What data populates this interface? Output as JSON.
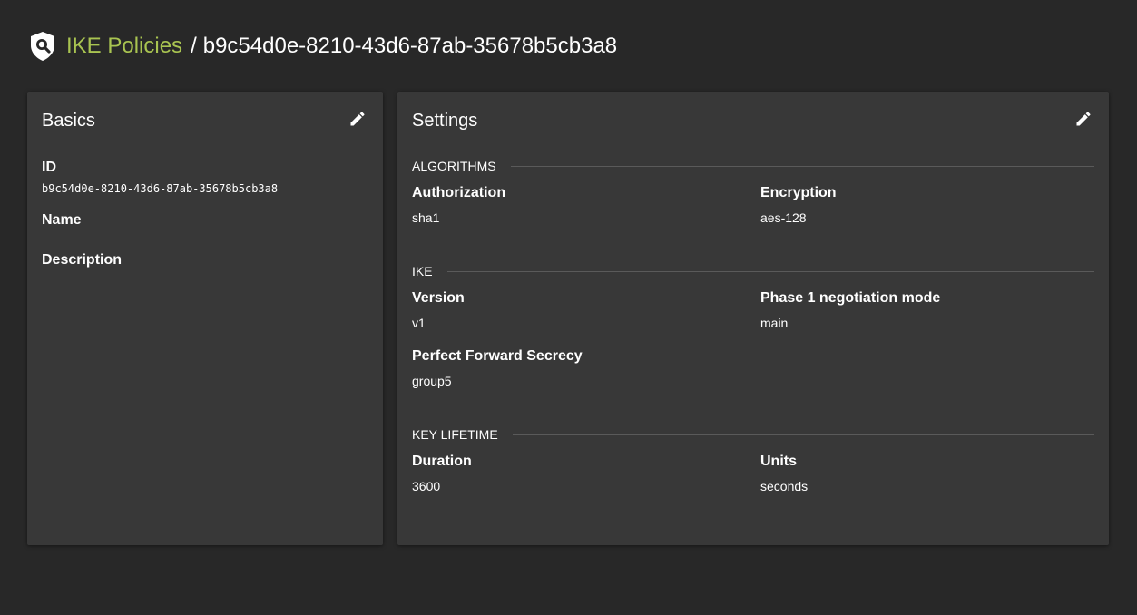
{
  "breadcrumb": {
    "icon": "shield-search-icon",
    "parent_label": "IKE Policies",
    "separator": "/",
    "current": "b9c54d0e-8210-43d6-87ab-35678b5cb3a8"
  },
  "colors": {
    "background": "#282828",
    "card": "#383838",
    "link": "#a9c451"
  },
  "basics": {
    "title": "Basics",
    "edit_icon": "pencil-icon",
    "id_label": "ID",
    "id_value": "b9c54d0e-8210-43d6-87ab-35678b5cb3a8",
    "name_label": "Name",
    "description_label": "Description"
  },
  "settings": {
    "title": "Settings",
    "edit_icon": "pencil-icon",
    "algorithms": {
      "heading": "ALGORITHMS",
      "authorization_label": "Authorization",
      "authorization_value": "sha1",
      "encryption_label": "Encryption",
      "encryption_value": "aes-128"
    },
    "ike": {
      "heading": "IKE",
      "version_label": "Version",
      "version_value": "v1",
      "phase1_label": "Phase 1 negotiation mode",
      "phase1_value": "main",
      "pfs_label": "Perfect Forward Secrecy",
      "pfs_value": "group5"
    },
    "key_lifetime": {
      "heading": "KEY LIFETIME",
      "duration_label": "Duration",
      "duration_value": "3600",
      "units_label": "Units",
      "units_value": "seconds"
    }
  }
}
